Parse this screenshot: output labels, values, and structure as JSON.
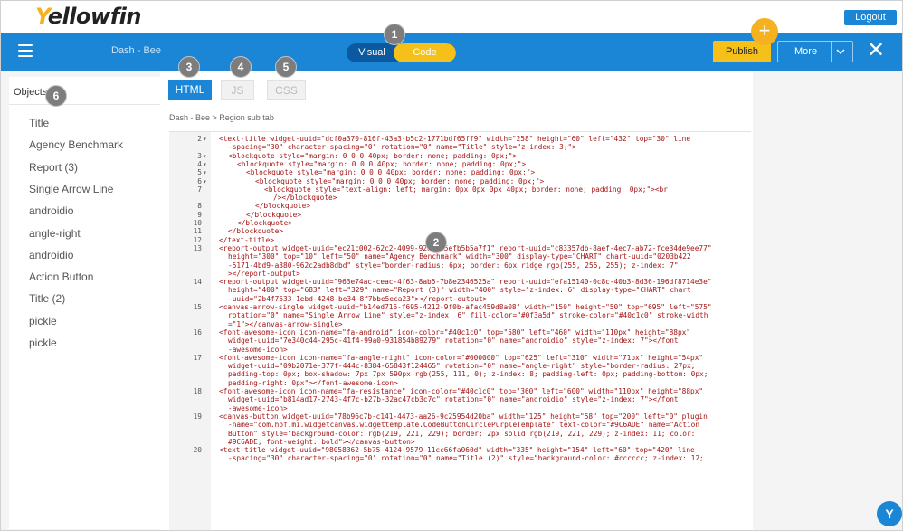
{
  "app": {
    "logo_first": "Y",
    "logo_rest": "ellowfin",
    "logout_label": "Logout"
  },
  "nav": {
    "dashboard_name": "Dash - Bee",
    "view_toggle": {
      "visual_label": "Visual",
      "code_label": "Code",
      "selected": "Code"
    },
    "publish_label": "Publish",
    "add_glyph": "+",
    "more_label": "More",
    "more_chevron": "⌵",
    "close_glyph": "✕",
    "hamburger_icon": "menu-icon"
  },
  "colors": {
    "brand_blue": "#1b86d6",
    "brand_yellow": "#f5c01a",
    "code_red": "#a31515"
  },
  "objects": {
    "title": "Objects",
    "items": [
      "Title",
      "Agency Benchmark",
      "Report (3)",
      "Single Arrow Line",
      "androidio",
      "angle-right",
      "androidio",
      "Action Button",
      "Title (2)",
      "pickle",
      "pickle"
    ]
  },
  "editor": {
    "tabs": [
      "HTML",
      "JS",
      "CSS"
    ],
    "active_tab": "HTML",
    "breadcrumb": "Dash - Bee > Region sub tab",
    "lines": [
      {
        "n": "2",
        "fold": true,
        "indent": 0,
        "text": "<text-title widget-uuid=\"dcf0a370-816f-43a3-b5c2-1771bdf65ff9\" width=\"258\" height=\"60\" left=\"432\" top=\"30\" line"
      },
      {
        "n": "",
        "fold": false,
        "indent": 1,
        "text": "-spacing=\"30\" character-spacing=\"0\" rotation=\"0\" name=\"Title\" style=\"z-index: 3;\">"
      },
      {
        "n": "3",
        "fold": true,
        "indent": 1,
        "text": "<blockquote style=\"margin: 0 0 0 40px; border: none; padding: 0px;\">"
      },
      {
        "n": "4",
        "fold": true,
        "indent": 2,
        "text": "<blockquote style=\"margin: 0 0 0 40px; border: none; padding: 0px;\">"
      },
      {
        "n": "5",
        "fold": true,
        "indent": 3,
        "text": "<blockquote style=\"margin: 0 0 0 40px; border: none; padding: 0px;\">"
      },
      {
        "n": "6",
        "fold": true,
        "indent": 4,
        "text": "<blockquote style=\"margin: 0 0 0 40px; border: none; padding: 0px;\">"
      },
      {
        "n": "7",
        "fold": false,
        "indent": 5,
        "text": "<blockquote style=\"text-align: left; margin: 0px 0px 0px 40px; border: none; padding: 0px;\"><br"
      },
      {
        "n": "",
        "fold": false,
        "indent": 6,
        "text": "/></blockquote>"
      },
      {
        "n": "8",
        "fold": false,
        "indent": 4,
        "text": "</blockquote>"
      },
      {
        "n": "9",
        "fold": false,
        "indent": 3,
        "text": "</blockquote>"
      },
      {
        "n": "10",
        "fold": false,
        "indent": 2,
        "text": "</blockquote>"
      },
      {
        "n": "11",
        "fold": false,
        "indent": 1,
        "text": "</blockquote>"
      },
      {
        "n": "12",
        "fold": false,
        "indent": 0,
        "text": "</text-title>"
      },
      {
        "n": "13",
        "fold": false,
        "indent": 0,
        "text": "<report-output widget-uuid=\"ec21c002-62c2-4099-92d8-45efb5b5a7f1\" report-uuid=\"c83357db-8aef-4ec7-ab72-fce34de9ee77\""
      },
      {
        "n": "",
        "fold": false,
        "indent": 1,
        "text": "height=\"300\" top=\"10\" left=\"50\" name=\"Agency Benchmark\" width=\"300\" display-type=\"CHART\" chart-uuid=\"0203b422"
      },
      {
        "n": "",
        "fold": false,
        "indent": 1,
        "text": "-5171-4bd9-a380-962c2adb8dbd\" style=\"border-radius: 6px; border: 6px ridge rgb(255, 255, 255); z-index: 7\""
      },
      {
        "n": "",
        "fold": false,
        "indent": 1,
        "text": "></report-output>"
      },
      {
        "n": "14",
        "fold": false,
        "indent": 0,
        "text": "<report-output widget-uuid=\"963e74ac-ceac-4f63-8ab5-7b8e2346525a\" report-uuid=\"efa15140-0c8c-40b3-8d36-196df8714e3e\""
      },
      {
        "n": "",
        "fold": false,
        "indent": 1,
        "text": "height=\"400\" top=\"683\" left=\"329\" name=\"Report (3)\" width=\"400\" style=\"z-index: 6\" display-type=\"CHART\" chart"
      },
      {
        "n": "",
        "fold": false,
        "indent": 1,
        "text": "-uuid=\"2b4f7533-1ebd-4248-be34-8f7bbe5eca23\"></report-output>"
      },
      {
        "n": "15",
        "fold": false,
        "indent": 0,
        "text": "<canvas-arrow-single widget-uuid=\"b14ed716-f695-4212-9f0b-afac459d8a08\" width=\"150\" height=\"50\" top=\"695\" left=\"575\""
      },
      {
        "n": "",
        "fold": false,
        "indent": 1,
        "text": "rotation=\"0\" name=\"Single Arrow Line\" style=\"z-index: 6\" fill-color=\"#0f3a5d\" stroke-color=\"#40c1c0\" stroke-width"
      },
      {
        "n": "",
        "fold": false,
        "indent": 1,
        "text": "=\"1\"></canvas-arrow-single>"
      },
      {
        "n": "16",
        "fold": false,
        "indent": 0,
        "text": "<font-awesome-icon icon-name=\"fa-android\" icon-color=\"#40c1c0\" top=\"580\" left=\"460\" width=\"110px\" height=\"88px\""
      },
      {
        "n": "",
        "fold": false,
        "indent": 1,
        "text": "widget-uuid=\"7e340c44-295c-41f4-99a0-931854b89279\" rotation=\"0\" name=\"androidio\" style=\"z-index: 7\"></font"
      },
      {
        "n": "",
        "fold": false,
        "indent": 1,
        "text": "-awesome-icon>"
      },
      {
        "n": "17",
        "fold": false,
        "indent": 0,
        "text": "<font-awesome-icon icon-name=\"fa-angle-right\" icon-color=\"#000000\" top=\"625\" left=\"310\" width=\"71px\" height=\"54px\""
      },
      {
        "n": "",
        "fold": false,
        "indent": 1,
        "text": "widget-uuid=\"09b2071e-377f-444c-8384-65843f124465\" rotation=\"0\" name=\"angle-right\" style=\"border-radius: 27px;"
      },
      {
        "n": "",
        "fold": false,
        "indent": 1,
        "text": "padding-top: 0px; box-shadow: 7px 7px 590px rgb(255, 111, 0); z-index: 8; padding-left: 0px; padding-bottom: 0px;"
      },
      {
        "n": "",
        "fold": false,
        "indent": 1,
        "text": "padding-right: 0px\"></font-awesome-icon>"
      },
      {
        "n": "18",
        "fold": false,
        "indent": 0,
        "text": "<font-awesome-icon icon-name=\"fa-resistance\" icon-color=\"#40c1c0\" top=\"360\" left=\"600\" width=\"110px\" height=\"88px\""
      },
      {
        "n": "",
        "fold": false,
        "indent": 1,
        "text": "widget-uuid=\"b814ad17-2743-4f7c-b27b-32ac47cb3c7c\" rotation=\"0\" name=\"androidio\" style=\"z-index: 7\"></font"
      },
      {
        "n": "",
        "fold": false,
        "indent": 1,
        "text": "-awesome-icon>"
      },
      {
        "n": "19",
        "fold": false,
        "indent": 0,
        "text": "<canvas-button widget-uuid=\"78b96c7b-c141-4473-aa26-9c25954d20ba\" width=\"125\" height=\"58\" top=\"200\" left=\"0\" plugin"
      },
      {
        "n": "",
        "fold": false,
        "indent": 1,
        "text": "-name=\"com.hof.mi.widgetcanvas.widgettemplate.CodeButtonCirclePurpleTemplate\" text-color=\"#9C6ADE\" name=\"Action"
      },
      {
        "n": "",
        "fold": false,
        "indent": 1,
        "text": "Button\" style=\"background-color: rgb(219, 221, 229); border: 2px solid rgb(219, 221, 229); z-index: 11; color:"
      },
      {
        "n": "",
        "fold": false,
        "indent": 1,
        "text": "#9C6ADE; font-weight: bold\"></canvas-button>"
      },
      {
        "n": "20",
        "fold": false,
        "indent": 0,
        "text": "<text-title widget-uuid=\"98058362-5b75-4124-9579-11cc66fa060d\" width=\"335\" height=\"154\" left=\"60\" top=\"420\" line"
      },
      {
        "n": "",
        "fold": false,
        "indent": 1,
        "text": "-spacing=\"30\" character-spacing=\"0\" rotation=\"0\" name=\"Title (2)\" style=\"background-color: #cccccc; z-index: 12;"
      }
    ]
  },
  "callouts": [
    "1",
    "2",
    "3",
    "4",
    "5",
    "6"
  ],
  "help_label": "Y"
}
